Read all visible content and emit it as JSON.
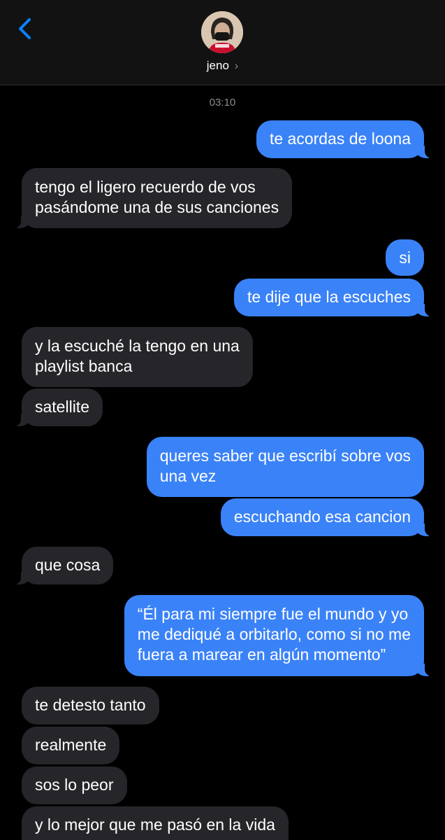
{
  "header": {
    "contact_name": "jeno",
    "back_icon": "chevron-left-icon",
    "chevron_icon": "chevron-right-icon"
  },
  "conversation": {
    "timestamp": "03:10",
    "messages": [
      {
        "from": "me",
        "text": "te acordas de loona"
      },
      {
        "from": "them",
        "lines": [
          "tengo el ligero recuerdo de vos",
          "pasándome una de sus canciones"
        ]
      },
      {
        "from": "me",
        "text": "si"
      },
      {
        "from": "me",
        "text": "te dije que la escuches"
      },
      {
        "from": "them",
        "lines": [
          "y la escuché la tengo en una",
          "playlist banca"
        ]
      },
      {
        "from": "them",
        "text": "satellite"
      },
      {
        "from": "me",
        "lines": [
          "queres saber que escribí sobre vos",
          "una vez"
        ]
      },
      {
        "from": "me",
        "text": "escuchando esa cancion"
      },
      {
        "from": "them",
        "text": "que cosa"
      },
      {
        "from": "me",
        "lines": [
          "“Él para mi siempre fue el mundo y yo",
          "me dediqué a orbitarlo, como si no me",
          "fuera a marear en algún momento”"
        ]
      },
      {
        "from": "them",
        "text": "te detesto tanto"
      },
      {
        "from": "them",
        "text": "realmente"
      },
      {
        "from": "them",
        "text": "sos lo peor"
      },
      {
        "from": "them",
        "text": "y lo mejor que me pasó en la vida"
      }
    ]
  },
  "colors": {
    "outgoing": "#3a82f7",
    "incoming": "#26252a",
    "background": "#000000",
    "accent": "#0a84ff"
  }
}
